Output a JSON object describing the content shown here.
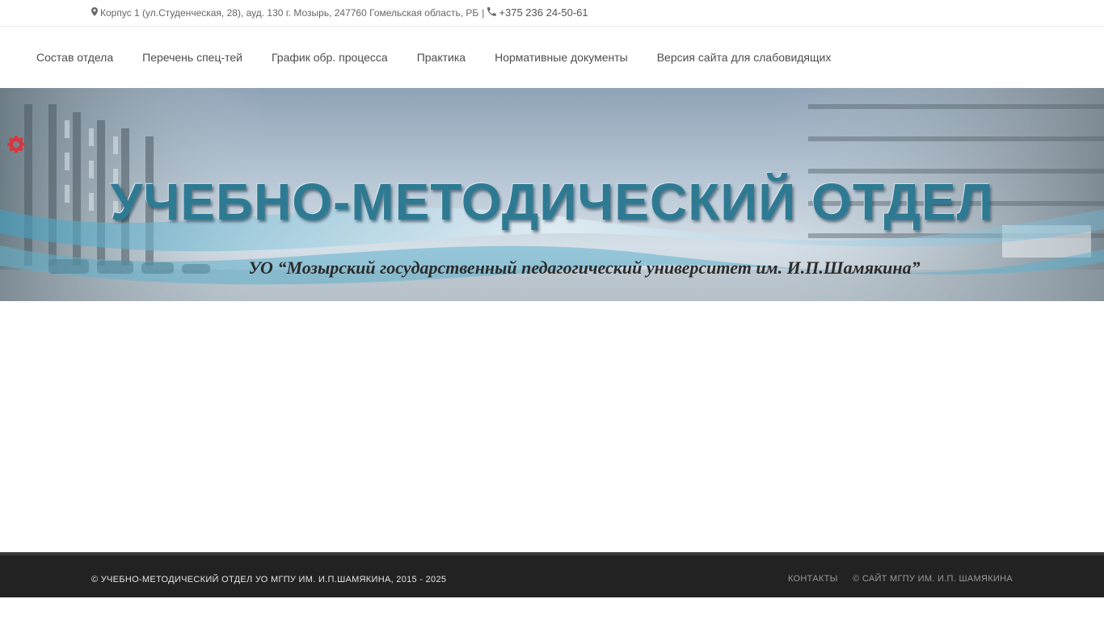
{
  "topbar": {
    "address_icon": "map-marker-icon",
    "address": "Корпус 1 (ул.Студенческая, 28), ауд. 130 г. Мозырь, 247760 Гомельская область, РБ",
    "separator": "|",
    "phone_icon": "phone-icon",
    "phone": "+375 236 24-50-61"
  },
  "nav": {
    "items": [
      "Состав отдела",
      "Перечень спец-тей",
      "График обр. процесса",
      "Практика",
      "Нормативные документы",
      "Версия сайта для слабовидящих"
    ]
  },
  "banner": {
    "title": "УЧЕБНО-МЕТОДИЧЕСКИЙ ОТДЕЛ",
    "subtitle": "УО “Мозырский государственный педагогический университет им. И.П.Шамякина”"
  },
  "settings": {
    "icon": "gear-icon",
    "color": "#d9363e"
  },
  "footer": {
    "copyright": "© Учебно-методический отдел УО МГПУ им. И.П.Шамякина, 2015 - 2025",
    "links": [
      "Контакты",
      "© сайт МГПУ им. И.П. Шамякина"
    ]
  }
}
